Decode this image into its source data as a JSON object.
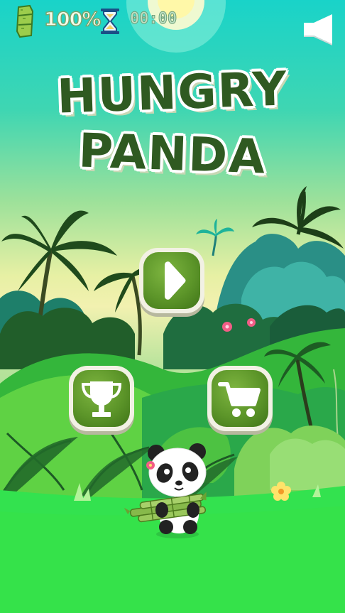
{
  "hud": {
    "bamboo_icon": "bamboo-icon",
    "percent": "100%",
    "hourglass_icon": "hourglass-icon",
    "timer": "00:00",
    "sound_icon": "speaker-icon"
  },
  "title": {
    "line1": "HUNGRY",
    "line2": "PANDA"
  },
  "buttons": {
    "play_icon": "play-icon",
    "leaderboard_icon": "trophy-icon",
    "shop_icon": "cart-icon"
  },
  "colors": {
    "title_green": "#2f5a21",
    "button_green": "#5c9529",
    "button_border": "#f2f1e4"
  }
}
